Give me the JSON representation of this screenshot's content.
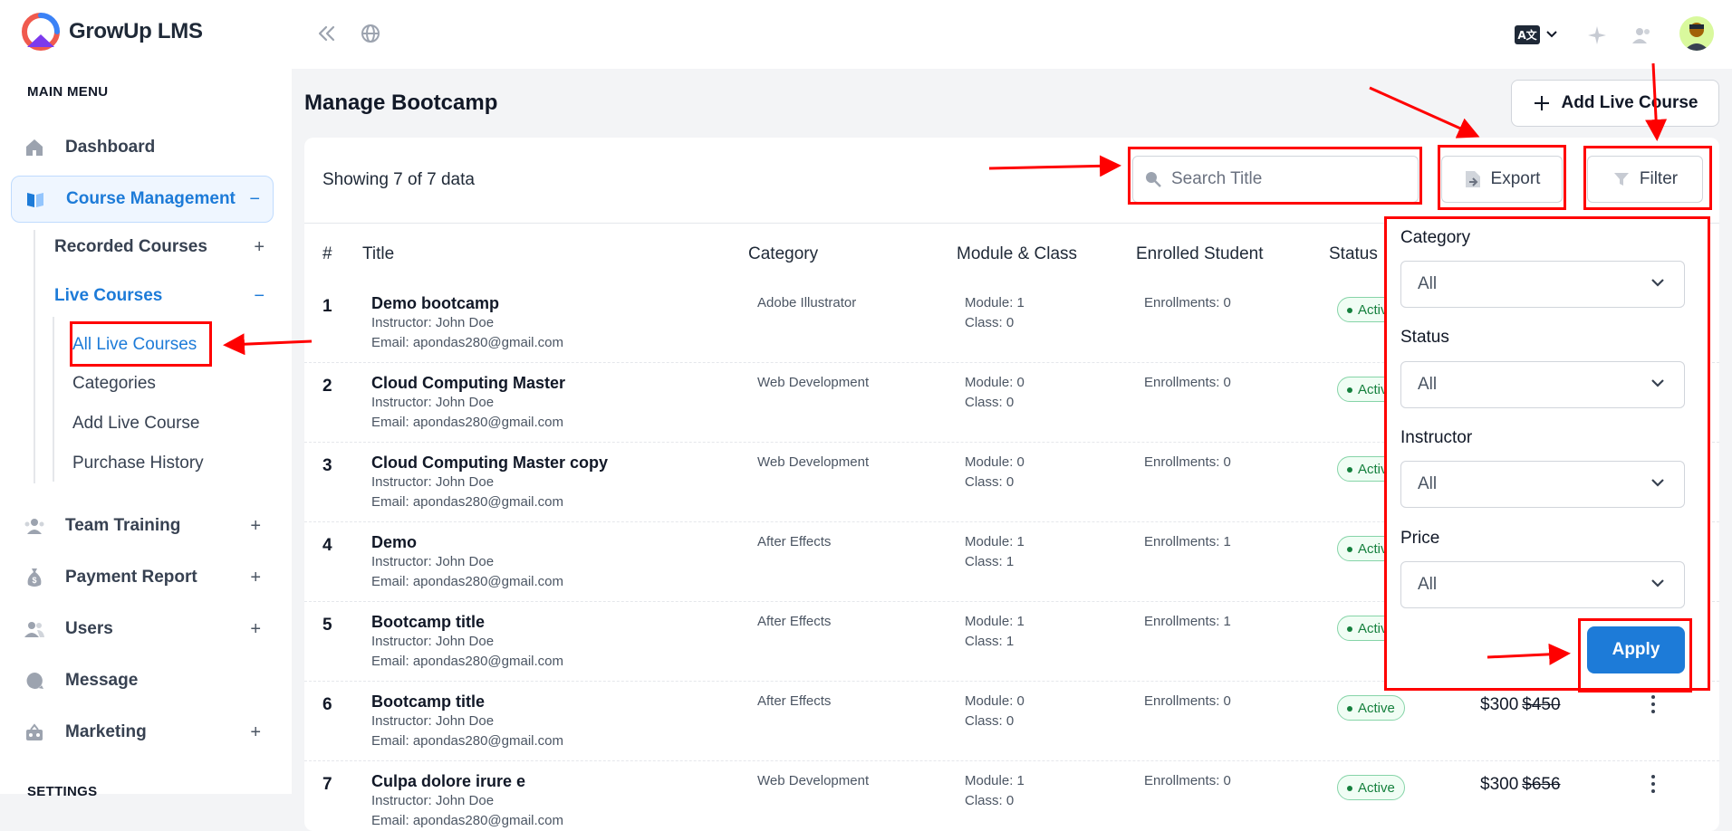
{
  "app": {
    "name": "GrowUp LMS"
  },
  "sidebar": {
    "main_menu_title": "MAIN MENU",
    "settings_title": "SETTINGS",
    "items": [
      {
        "label": "Dashboard",
        "icon": "home-icon",
        "toggle": ""
      },
      {
        "label": "Course Management",
        "icon": "book-icon",
        "toggle": "−"
      },
      {
        "label": "Team Training",
        "icon": "team-icon",
        "toggle": "+"
      },
      {
        "label": "Payment Report",
        "icon": "money-bag-icon",
        "toggle": "+"
      },
      {
        "label": "Users",
        "icon": "users-icon",
        "toggle": "+"
      },
      {
        "label": "Message",
        "icon": "message-icon",
        "toggle": ""
      },
      {
        "label": "Marketing",
        "icon": "marketing-icon",
        "toggle": "+"
      }
    ],
    "course_sub": [
      {
        "label": "Recorded Courses",
        "toggle": "+"
      },
      {
        "label": "Live Courses",
        "toggle": "−"
      }
    ],
    "live_sub": [
      {
        "label": "All Live Courses"
      },
      {
        "label": "Categories"
      },
      {
        "label": "Add Live Course"
      },
      {
        "label": "Purchase History"
      }
    ]
  },
  "topbar": {
    "language_badge": "A文"
  },
  "page": {
    "title": "Manage Bootcamp",
    "add_button": "Add Live Course",
    "showing": "Showing 7 of 7 data",
    "search_placeholder": "Search Title",
    "export_label": "Export",
    "filter_label": "Filter"
  },
  "table": {
    "headers": [
      "#",
      "Title",
      "Category",
      "Module & Class",
      "Enrolled Student",
      "Status"
    ],
    "rows": [
      {
        "num": "1",
        "title": "Demo bootcamp",
        "instructor": "Instructor: John Doe",
        "email": "Email: apondas280@gmail.com",
        "category": "Adobe Illustrator",
        "module": "Module: 1",
        "class": "Class: 0",
        "enrolled": "Enrollments: 0",
        "status": "Active",
        "price": "",
        "old_price": ""
      },
      {
        "num": "2",
        "title": "Cloud Computing Master",
        "instructor": "Instructor: John Doe",
        "email": "Email: apondas280@gmail.com",
        "category": "Web Development",
        "module": "Module: 0",
        "class": "Class: 0",
        "enrolled": "Enrollments: 0",
        "status": "Active",
        "price": "",
        "old_price": ""
      },
      {
        "num": "3",
        "title": "Cloud Computing Master copy",
        "instructor": "Instructor: John Doe",
        "email": "Email: apondas280@gmail.com",
        "category": "Web Development",
        "module": "Module: 0",
        "class": "Class: 0",
        "enrolled": "Enrollments: 0",
        "status": "Active",
        "price": "",
        "old_price": ""
      },
      {
        "num": "4",
        "title": "Demo",
        "instructor": "Instructor: John Doe",
        "email": "Email: apondas280@gmail.com",
        "category": "After Effects",
        "module": "Module: 1",
        "class": "Class: 1",
        "enrolled": "Enrollments: 1",
        "status": "Active",
        "price": "",
        "old_price": ""
      },
      {
        "num": "5",
        "title": "Bootcamp title",
        "instructor": "Instructor: John Doe",
        "email": "Email: apondas280@gmail.com",
        "category": "After Effects",
        "module": "Module: 1",
        "class": "Class: 1",
        "enrolled": "Enrollments: 1",
        "status": "Active",
        "price": "",
        "old_price": ""
      },
      {
        "num": "6",
        "title": "Bootcamp title",
        "instructor": "Instructor: John Doe",
        "email": "Email: apondas280@gmail.com",
        "category": "After Effects",
        "module": "Module: 0",
        "class": "Class: 0",
        "enrolled": "Enrollments: 0",
        "status": "Active",
        "price": "$300",
        "old_price": "$450"
      },
      {
        "num": "7",
        "title": "Culpa dolore irure e",
        "instructor": "Instructor: John Doe",
        "email": "Email: apondas280@gmail.com",
        "category": "Web Development",
        "module": "Module: 1",
        "class": "Class: 0",
        "enrolled": "Enrollments: 0",
        "status": "Active",
        "price": "$300",
        "old_price": "$656"
      }
    ]
  },
  "filter": {
    "fields": [
      {
        "label": "Category",
        "value": "All"
      },
      {
        "label": "Status",
        "value": "All"
      },
      {
        "label": "Instructor",
        "value": "All"
      },
      {
        "label": "Price",
        "value": "All"
      }
    ],
    "apply_label": "Apply"
  },
  "colors": {
    "accent": "#1d7bd8",
    "annotation": "#ff0000",
    "active_green": "#15803d"
  }
}
